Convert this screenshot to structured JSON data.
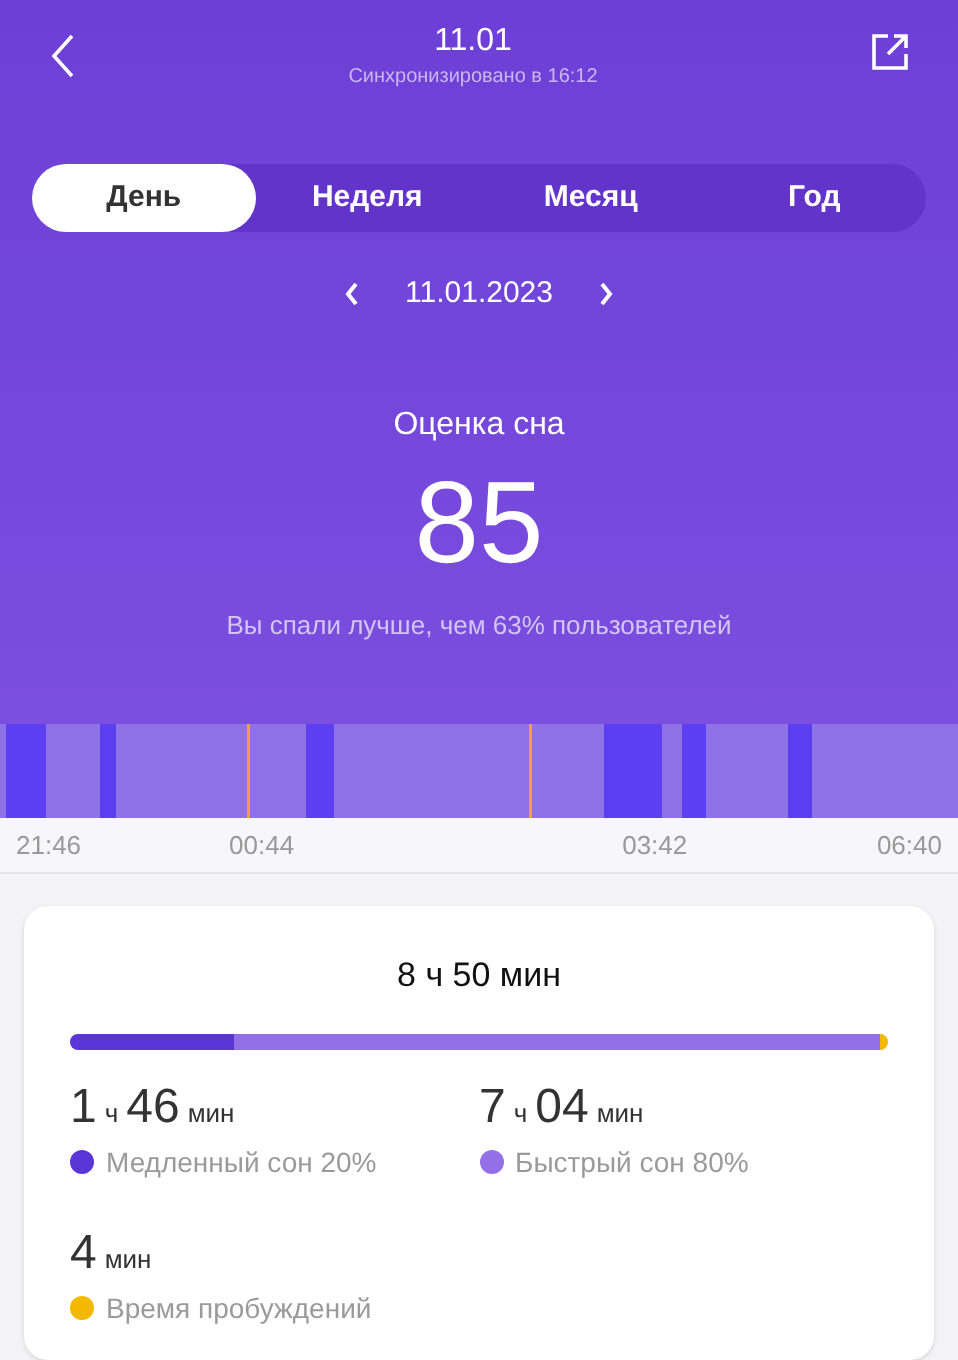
{
  "header": {
    "title": "11.01",
    "subtitle": "Синхронизировано в 16:12"
  },
  "tabs": [
    {
      "label": "День",
      "selected": true
    },
    {
      "label": "Неделя",
      "selected": false
    },
    {
      "label": "Месяц",
      "selected": false
    },
    {
      "label": "Год",
      "selected": false
    }
  ],
  "date_nav": {
    "date": "11.01.2023"
  },
  "score": {
    "label": "Оценка сна",
    "value": "85",
    "comparison": "Вы спали лучше, чем 63% пользователей"
  },
  "timeline": {
    "time_labels": [
      "21:46",
      "00:44",
      "03:42",
      "06:40"
    ]
  },
  "summary": {
    "total": "8 ч 50 мин",
    "stats": [
      {
        "parts": [
          {
            "kind": "number",
            "text": "1"
          },
          {
            "kind": "unit",
            "text": "ч"
          },
          {
            "kind": "number",
            "text": "46"
          },
          {
            "kind": "unit",
            "text": "мин"
          }
        ],
        "label": "Медленный сон 20%",
        "color": "#5a36d6",
        "level": 0.2
      },
      {
        "parts": [
          {
            "kind": "number",
            "text": "7"
          },
          {
            "kind": "unit",
            "text": "ч"
          },
          {
            "kind": "number",
            "text": "04"
          },
          {
            "kind": "unit",
            "text": "мин"
          }
        ],
        "label": "Быстрый сон 80%",
        "color": "#9370e8",
        "level": 0.79
      },
      {
        "parts": [
          {
            "kind": "number",
            "text": "4"
          },
          {
            "kind": "unit",
            "text": "мин"
          }
        ],
        "label": "Время пробуждений",
        "color": "#f5b800",
        "level": 0.01
      }
    ]
  }
}
